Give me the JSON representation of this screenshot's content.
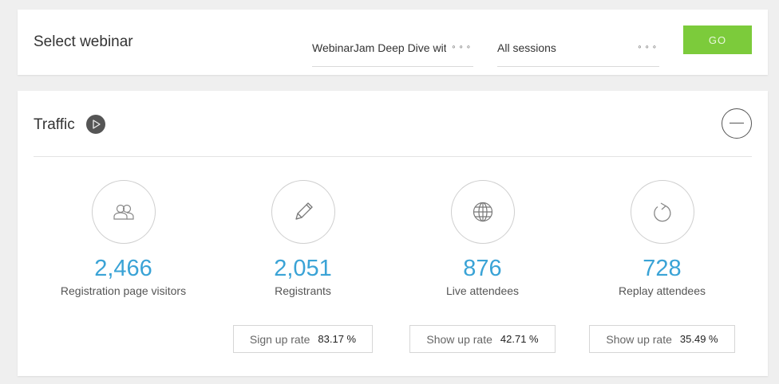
{
  "select_card": {
    "title": "Select webinar",
    "webinar_value": "WebinarJam Deep Dive with",
    "session_value": "All sessions",
    "dots": "∘∘∘",
    "go_label": "GO"
  },
  "traffic": {
    "title": "Traffic",
    "stats": [
      {
        "icon": "users-icon",
        "value": "2,466",
        "label": "Registration page visitors"
      },
      {
        "icon": "pencil-icon",
        "value": "2,051",
        "label": "Registrants"
      },
      {
        "icon": "globe-icon",
        "value": "876",
        "label": "Live attendees"
      },
      {
        "icon": "replay-icon",
        "value": "728",
        "label": "Replay attendees"
      }
    ],
    "rates": [
      {
        "label": "Sign up rate",
        "value": "83.17 %"
      },
      {
        "label": "Show up rate",
        "value": "42.71 %"
      },
      {
        "label": "Show up rate",
        "value": "35.49 %"
      }
    ]
  },
  "colors": {
    "accent_blue": "#3aa3d6",
    "go_green": "#7ccb3b",
    "background": "#efefef"
  }
}
